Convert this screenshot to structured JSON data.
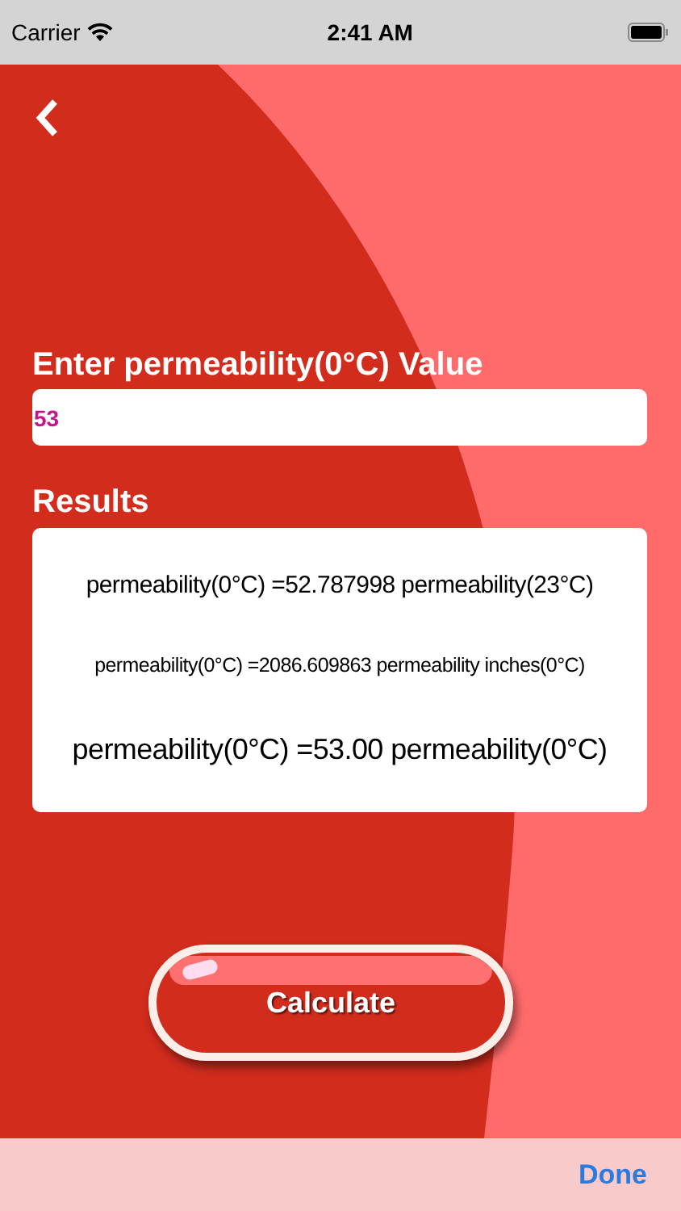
{
  "status_bar": {
    "carrier": "Carrier",
    "time": "2:41 AM"
  },
  "input": {
    "label": "Enter permeability(0°C) Value",
    "value": "53"
  },
  "results": {
    "title": "Results",
    "lines": [
      {
        "text": "permeability(0°C) =52.787998 permeability(23°C)",
        "kind": "medium"
      },
      {
        "text": "permeability(0°C) =2086.609863 permeability inches(0°C)",
        "kind": "small"
      },
      {
        "text": "permeability(0°C) =53.00 permeability(0°C)",
        "kind": "large"
      }
    ]
  },
  "button": {
    "label": "Calculate"
  },
  "keyboard_toolbar": {
    "done": "Done"
  }
}
